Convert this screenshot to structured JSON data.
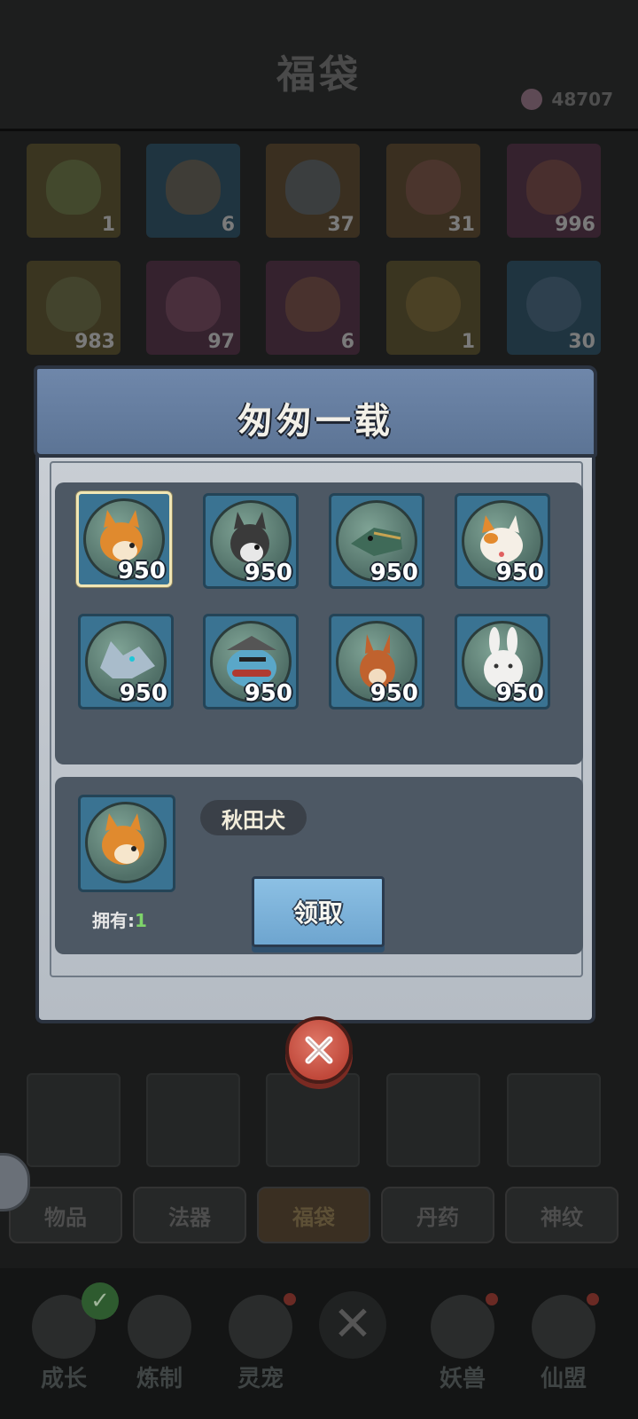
{
  "background": {
    "title": "福袋",
    "currency_amount": "48707",
    "bag_counts": [
      "1",
      "6",
      "37",
      "31",
      "996",
      "983",
      "97",
      "6",
      "1",
      "30"
    ],
    "tabs": [
      "物品",
      "法器",
      "福袋",
      "丹药",
      "神纹"
    ],
    "active_tab": "福袋",
    "nav": [
      "成长",
      "炼制",
      "灵宠",
      "妖兽",
      "仙盟"
    ]
  },
  "modal": {
    "title": "匆匆一载",
    "pets": [
      {
        "icon": "akita-dog-icon",
        "count": "950"
      },
      {
        "icon": "husky-dog-icon",
        "count": "950"
      },
      {
        "icon": "dragon-icon",
        "count": "950"
      },
      {
        "icon": "calico-cat-icon",
        "count": "950"
      },
      {
        "icon": "wolf-icon",
        "count": "950"
      },
      {
        "icon": "frog-hat-icon",
        "count": "950"
      },
      {
        "icon": "squirrel-icon",
        "count": "950"
      },
      {
        "icon": "rabbit-icon",
        "count": "950"
      }
    ],
    "selected": {
      "name": "秋田犬",
      "owned_label": "拥有:",
      "owned_value": "1"
    },
    "claim_label": "领取"
  },
  "colors": {
    "header_blue": "#6f87aa",
    "cell_blue": "#3a7392",
    "close_red": "#c0483a",
    "owned_green": "#7ed36a"
  }
}
